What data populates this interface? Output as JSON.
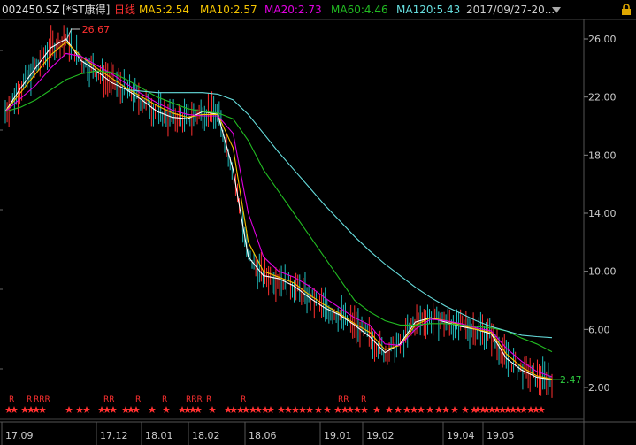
{
  "header": {
    "symbol": "002450.SZ",
    "name": "[*ST康得]",
    "period": "日线",
    "ma5": "MA5:2.54",
    "ma10": "MA10:2.57",
    "ma20": "MA20:2.73",
    "ma60": "MA60:4.46",
    "ma120": "MA120:5.43",
    "date_range": "2017/09/27-20..."
  },
  "colors": {
    "ma5": "#ffffff",
    "ma10": "#f5c400",
    "ma20": "#e000e0",
    "ma60": "#22bb22",
    "ma120": "#66dddd",
    "up": "#ff3030",
    "down": "#20c0c0",
    "axis": "#cccccc",
    "grid": "#333333"
  },
  "chart_data": {
    "type": "line",
    "ylim": [
      1.0,
      27.5
    ],
    "y_ticks": [
      "26.00",
      "22.00",
      "18.00",
      "14.00",
      "10.00",
      "6.00",
      "2.00"
    ],
    "x_ticks": [
      "17.09",
      "17.12",
      "18.01",
      "18.02",
      "18.06",
      "19.01",
      "19.02",
      "19.04",
      "19.05"
    ],
    "annotations": {
      "high": "26.67",
      "last": "2.47"
    },
    "series": [
      {
        "name": "MA5",
        "values": [
          21.0,
          22.6,
          24.0,
          25.4,
          26.0,
          24.5,
          23.8,
          23.0,
          22.5,
          21.8,
          21.0,
          20.6,
          20.5,
          21.0,
          20.8,
          17.0,
          11.0,
          9.7,
          9.5,
          9.0,
          8.2,
          7.5,
          7.0,
          6.3,
          5.5,
          4.4,
          5.0,
          6.5,
          6.8,
          6.5,
          6.2,
          6.0,
          5.7,
          4.0,
          3.2,
          2.7,
          2.54
        ]
      },
      {
        "name": "MA10",
        "values": [
          21.0,
          22.3,
          23.6,
          24.9,
          25.8,
          24.8,
          24.0,
          23.3,
          22.6,
          22.0,
          21.4,
          20.9,
          20.6,
          20.8,
          20.8,
          18.5,
          12.0,
          10.0,
          9.6,
          9.2,
          8.4,
          7.7,
          7.1,
          6.4,
          5.8,
          4.6,
          4.9,
          6.3,
          6.8,
          6.6,
          6.3,
          6.0,
          5.8,
          4.3,
          3.4,
          2.8,
          2.57
        ]
      },
      {
        "name": "MA20",
        "values": [
          21.0,
          21.9,
          22.8,
          24.0,
          25.0,
          24.8,
          24.2,
          23.6,
          22.9,
          22.2,
          21.6,
          21.1,
          20.8,
          20.7,
          20.7,
          19.5,
          14.0,
          11.0,
          10.0,
          9.6,
          9.0,
          8.2,
          7.5,
          6.8,
          6.3,
          5.0,
          4.9,
          6.0,
          6.7,
          6.6,
          6.4,
          6.1,
          5.9,
          4.7,
          3.8,
          3.1,
          2.73
        ]
      },
      {
        "name": "MA60",
        "values": [
          21.0,
          21.3,
          21.8,
          22.5,
          23.2,
          23.6,
          23.8,
          23.7,
          23.2,
          22.6,
          22.0,
          21.6,
          21.2,
          21.0,
          20.9,
          20.5,
          19.0,
          17.0,
          15.5,
          14.0,
          12.5,
          11.0,
          9.5,
          8.0,
          7.2,
          6.6,
          6.3,
          6.3,
          6.4,
          6.4,
          6.3,
          6.2,
          6.1,
          5.9,
          5.4,
          5.0,
          4.46
        ]
      },
      {
        "name": "MA120",
        "values": [
          null,
          null,
          null,
          null,
          null,
          null,
          null,
          null,
          22.5,
          22.4,
          22.3,
          22.3,
          22.3,
          22.3,
          22.2,
          21.8,
          20.8,
          19.5,
          18.2,
          17.0,
          15.8,
          14.6,
          13.5,
          12.4,
          11.4,
          10.5,
          9.7,
          8.9,
          8.2,
          7.6,
          7.1,
          6.6,
          6.2,
          5.9,
          5.6,
          5.5,
          5.43
        ]
      }
    ]
  },
  "markers": [
    "R",
    "R",
    "RRR",
    "RR",
    "R",
    "R",
    "RRR",
    "R",
    "R",
    "RR",
    "R"
  ]
}
